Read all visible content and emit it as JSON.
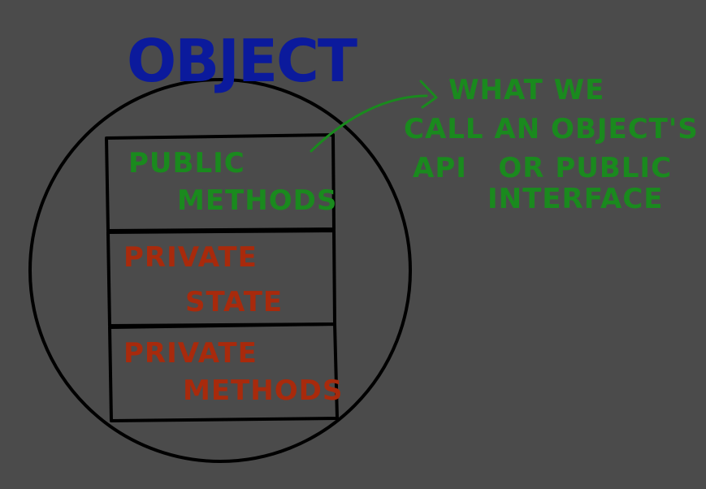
{
  "colors": {
    "background": "#4b4b4b",
    "ink": "#000000",
    "title": "#0b1a9c",
    "public": "#1a8a1e",
    "private": "#a82a0c"
  },
  "diagram": {
    "title": "OBJECT",
    "sections": [
      {
        "line1": "PUBLIC",
        "line2": "METHODS",
        "color": "#1a8a1e"
      },
      {
        "line1": "PRIVATE",
        "line2": "STATE",
        "color": "#a82a0c"
      },
      {
        "line1": "PRIVATE",
        "line2": "METHODS",
        "color": "#a82a0c"
      }
    ],
    "annotation": {
      "lines": [
        "WHAT WE",
        "CALL AN OBJECT'S",
        "API   OR PUBLIC",
        "INTERFACE"
      ],
      "color": "#1a8a1e"
    }
  }
}
